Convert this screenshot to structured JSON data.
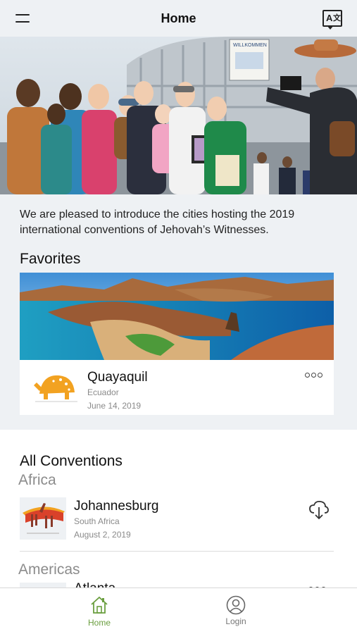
{
  "header": {
    "title": "Home",
    "menu_icon": "hamburger-menu-icon",
    "language_icon": "translate-language-icon"
  },
  "hero": {
    "banner_text": "WILLKOMMEN"
  },
  "intro_text": "We are pleased to introduce the cities hosting the 2019 international conventions of Jehovah’s Witnesses.",
  "favorites": {
    "heading": "Favorites",
    "items": [
      {
        "city": "Quayaquil",
        "country": "Ecuador",
        "date": "June 14, 2019",
        "thumb_icon": "tortoise-icon"
      }
    ]
  },
  "all_conventions": {
    "heading": "All Conventions",
    "regions": [
      {
        "name": "Africa",
        "items": [
          {
            "city": "Johannesburg",
            "country": "South Africa",
            "date": "August 2, 2019",
            "thumb_icon": "giraffes-icon",
            "action_icon": "cloud-download-icon"
          }
        ]
      },
      {
        "name": "Americas",
        "items": [
          {
            "city": "Atlanta"
          }
        ]
      }
    ]
  },
  "tabbar": {
    "tabs": [
      {
        "label": "Home",
        "icon": "home-icon",
        "active": true
      },
      {
        "label": "Login",
        "icon": "user-icon",
        "active": false
      }
    ]
  },
  "colors": {
    "background": "#eef1f4",
    "active_tab": "#6a9e3f",
    "accent_orange": "#f2a221",
    "muted_text": "#8a8a8a"
  }
}
